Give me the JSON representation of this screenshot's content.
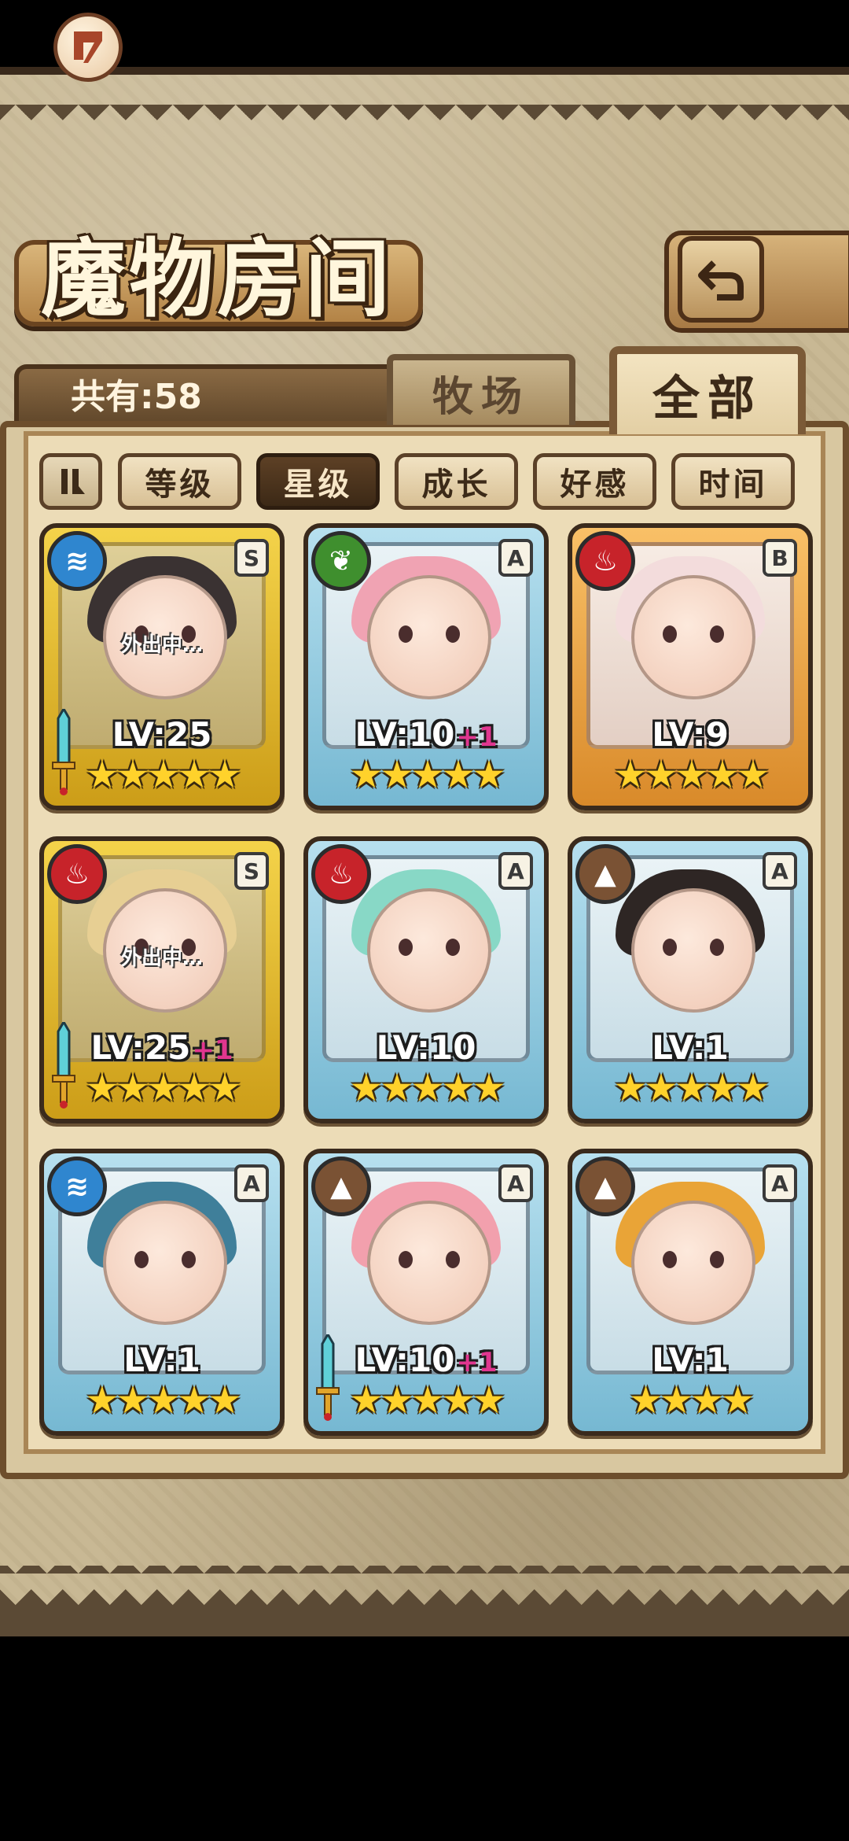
{
  "header": {
    "title": "魔物房间"
  },
  "count": {
    "label": "共有:58"
  },
  "top_tabs": {
    "ranch": "牧场",
    "all": "全部",
    "active": "all"
  },
  "sort": {
    "buttons": [
      "等级",
      "星级",
      "成长",
      "好感",
      "时间"
    ],
    "active": "星级"
  },
  "status_text": "外出中…",
  "colors": {
    "rank_S": "#f4d34a",
    "rank_A": "#b7e0ef",
    "rank_B": "#f9c067",
    "bonus": "#e0368f",
    "star": "#ffd22b"
  },
  "monsters": [
    {
      "element": "water",
      "rank": "S",
      "level": "LV:25",
      "bonus": "",
      "stars": 5,
      "away": true,
      "equipped": true,
      "hair": "#3a3232"
    },
    {
      "element": "wood",
      "rank": "A",
      "level": "LV:10",
      "bonus": "+1",
      "stars": 5,
      "away": false,
      "equipped": false,
      "hair": "#f0a3b3"
    },
    {
      "element": "fire",
      "rank": "B",
      "level": "LV:9",
      "bonus": "",
      "stars": 5,
      "away": false,
      "equipped": false,
      "hair": "#f3dcdc"
    },
    {
      "element": "fire",
      "rank": "S",
      "level": "LV:25",
      "bonus": "+1",
      "stars": 5,
      "away": true,
      "equipped": true,
      "hair": "#e7cf93"
    },
    {
      "element": "fire",
      "rank": "A",
      "level": "LV:10",
      "bonus": "",
      "stars": 5,
      "away": false,
      "equipped": false,
      "hair": "#88d8c6"
    },
    {
      "element": "earth",
      "rank": "A",
      "level": "LV:1",
      "bonus": "",
      "stars": 5,
      "away": false,
      "equipped": false,
      "hair": "#2e2624"
    },
    {
      "element": "water",
      "rank": "A",
      "level": "LV:1",
      "bonus": "",
      "stars": 5,
      "away": false,
      "equipped": false,
      "hair": "#3f7f9a"
    },
    {
      "element": "earth",
      "rank": "A",
      "level": "LV:10",
      "bonus": "+1",
      "stars": 5,
      "away": false,
      "equipped": true,
      "hair": "#f2a0ad"
    },
    {
      "element": "earth",
      "rank": "A",
      "level": "LV:1",
      "bonus": "",
      "stars": 4,
      "away": false,
      "equipped": false,
      "hair": "#e9a437"
    }
  ]
}
